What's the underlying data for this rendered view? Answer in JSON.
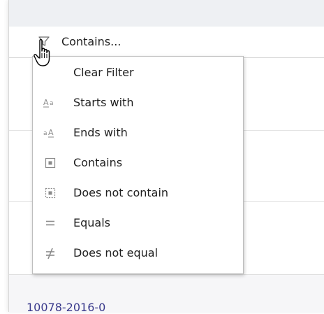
{
  "filter": {
    "value": "Contains...",
    "icon": "filter-icon"
  },
  "menu": {
    "items": [
      {
        "label": "Clear Filter",
        "icon": ""
      },
      {
        "label": "Starts with",
        "icon": "starts-with-icon"
      },
      {
        "label": "Ends with",
        "icon": "ends-with-icon"
      },
      {
        "label": "Contains",
        "icon": "contains-icon"
      },
      {
        "label": "Does not contain",
        "icon": "does-not-contain-icon"
      },
      {
        "label": "Equals",
        "icon": "equals-icon"
      },
      {
        "label": "Does not equal",
        "icon": "not-equal-icon"
      }
    ]
  },
  "grid": {
    "partial_cell": "10078-2016-0"
  },
  "colors": {
    "header_band": "#eef0f3",
    "menu_border": "#bdbdbd",
    "icon_gray": "#8a8a8a",
    "cell_text": "#3a3a8c"
  },
  "cursor": "hand-pointer-icon"
}
